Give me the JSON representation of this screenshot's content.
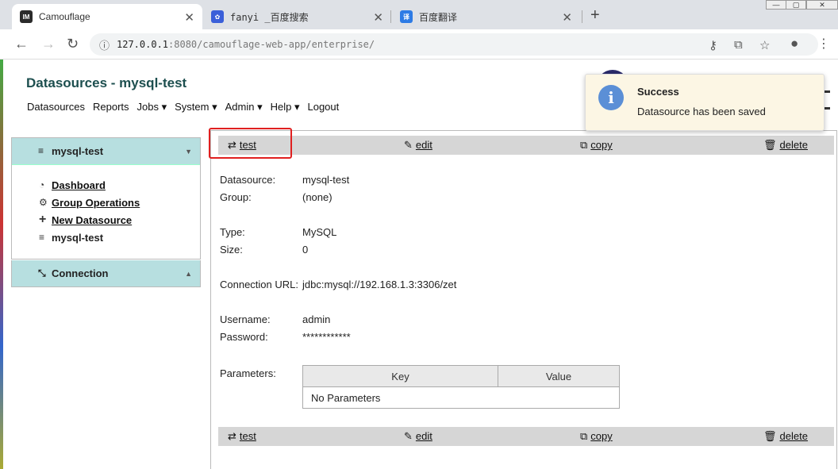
{
  "browser": {
    "tabs": [
      {
        "title": "Camouflage",
        "icon": "IM",
        "color": "#2b2b2b"
      },
      {
        "title": "fanyi _百度搜索",
        "icon": "baidu-paw-icon",
        "color": "#3a5fd9"
      },
      {
        "title": "百度翻译",
        "icon": "译",
        "color": "#2d7be5"
      }
    ],
    "url_host": "127.0.0.1",
    "url_rest": ":8080/camouflage-web-app/enterprise/"
  },
  "app": {
    "title": "Datasources - mysql-test",
    "nav": [
      "Datasources",
      "Reports",
      "Jobs ▾",
      "System ▾",
      "Admin ▾",
      "Help ▾",
      "Logout"
    ]
  },
  "sidebar": {
    "panel_title": "mysql-test",
    "links": [
      {
        "label": "Dashboard",
        "icon": "gauge-icon",
        "glyph": "◔"
      },
      {
        "label": "Group Operations",
        "icon": "gears-icon",
        "glyph": "⚙"
      },
      {
        "label": "New Datasource",
        "icon": "plus-icon",
        "glyph": "+"
      },
      {
        "label": "mysql-test",
        "icon": "database-icon",
        "glyph": "≡"
      }
    ],
    "connection_title": "Connection"
  },
  "actions": {
    "test": "test",
    "edit": "edit",
    "copy": "copy",
    "delete": "delete"
  },
  "details": {
    "datasource_label": "Datasource:",
    "datasource": "mysql-test",
    "group_label": "Group:",
    "group": "(none)",
    "type_label": "Type:",
    "type": "MySQL",
    "size_label": "Size:",
    "size": "0",
    "url_label": "Connection URL:",
    "url": "jdbc:mysql://192.168.1.3:3306/zet",
    "username_label": "Username:",
    "username": "admin",
    "password_label": "Password:",
    "password": "************",
    "parameters_label": "Parameters:",
    "param_headers": [
      "Key",
      "Value"
    ],
    "param_empty": "No Parameters"
  },
  "toast": {
    "title": "Success",
    "message": "Datasource has been saved"
  }
}
